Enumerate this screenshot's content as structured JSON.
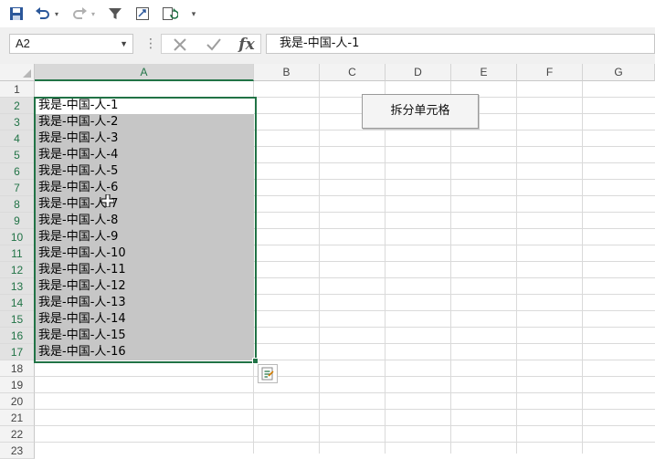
{
  "toolbar": {
    "icons": [
      "save-icon",
      "undo-icon",
      "redo-icon",
      "filter-icon",
      "pivot-icon",
      "refresh-icon",
      "customize-icon"
    ]
  },
  "formula_bar": {
    "name_box": "A2",
    "formula": "我是-中国-人-1",
    "fx_label": "fx",
    "separator": "⋮"
  },
  "columns": [
    "A",
    "B",
    "C",
    "D",
    "E",
    "F",
    "G"
  ],
  "rows": [
    "1",
    "2",
    "3",
    "4",
    "5",
    "6",
    "7",
    "8",
    "9",
    "10",
    "11",
    "12",
    "13",
    "14",
    "15",
    "16",
    "17",
    "18",
    "19",
    "20",
    "21",
    "22",
    "23"
  ],
  "cells_A": [
    "",
    "我是-中国-人-1",
    "我是-中国-人-2",
    "我是-中国-人-3",
    "我是-中国-人-4",
    "我是-中国-人-5",
    "我是-中国-人-6",
    "我是-中国-人-7",
    "我是-中国-人-8",
    "我是-中国-人-9",
    "我是-中国-人-10",
    "我是-中国-人-11",
    "我是-中国-人-12",
    "我是-中国-人-13",
    "我是-中国-人-14",
    "我是-中国-人-15",
    "我是-中国-人-16"
  ],
  "button": {
    "label": "拆分单元格"
  },
  "colors": {
    "accent": "#217346",
    "selection_fill": "#c6c6c6",
    "header_bg": "#f3f3f3"
  }
}
